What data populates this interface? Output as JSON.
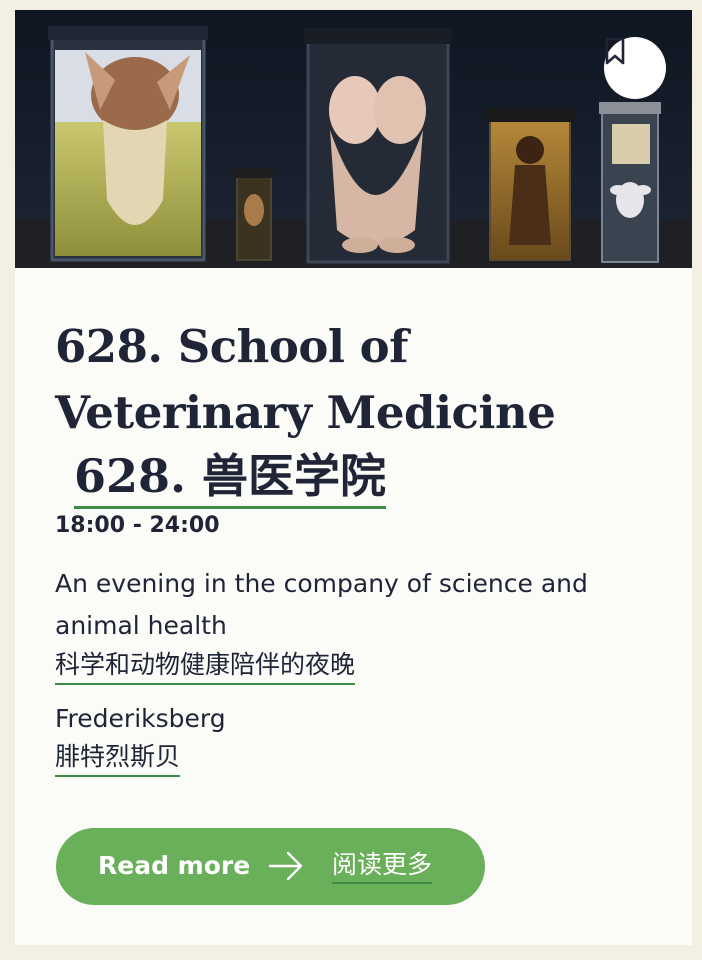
{
  "event": {
    "title_en": "628. School of Veterinary Medicine",
    "title_zh": "628. 兽医学院",
    "time": "18:00 - 24:00",
    "description_en": "An evening in the company of science and animal health",
    "description_zh": "科学和动物健康陪伴的夜晚",
    "location_en": "Frederiksberg",
    "location_zh": "腓特烈斯贝",
    "read_more_label": "Read more",
    "read_more_zh": "阅读更多"
  },
  "icons": {
    "bookmark": "bookmark-icon",
    "arrow": "arrow-right-icon"
  },
  "colors": {
    "page_background": "#f3efe3",
    "card_background": "#fbfcf7",
    "text": "#1f2436",
    "accent_green": "#6aaf59",
    "underline_green": "#3c8c45"
  }
}
